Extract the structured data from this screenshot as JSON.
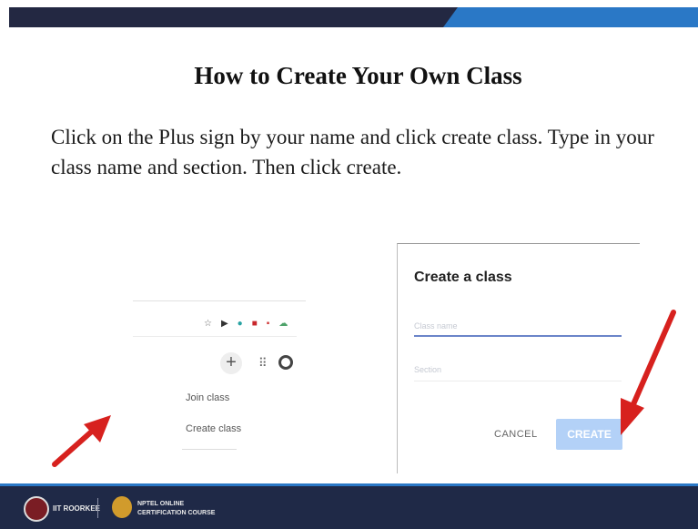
{
  "slide": {
    "title": "How to Create Your Own Class",
    "body": "Click on the Plus sign by your name and click create class. Type in your class name and section. Then click create."
  },
  "classroom_header": {
    "extension_icons": [
      "star-icon",
      "play-icon",
      "globe-icon",
      "red-square-icon",
      "red-bookmark-icon",
      "cloud-icon"
    ],
    "plus_label": "+",
    "apps_label": "⠿",
    "menu": {
      "join_label": "Join class",
      "create_label": "Create class"
    }
  },
  "dialog": {
    "title": "Create a class",
    "class_name_placeholder": "Class name",
    "section_placeholder": "Section",
    "cancel_label": "CANCEL",
    "create_label": "CREATE"
  },
  "footer": {
    "iitr_label": "IIT ROORKEE",
    "nptel_line1": "NPTEL ONLINE",
    "nptel_line2": "CERTIFICATION COURSE"
  },
  "colors": {
    "header_bar": "#232842",
    "accent": "#2a78c6",
    "arrow": "#d7211e",
    "create_button": "#b3d1f7"
  }
}
